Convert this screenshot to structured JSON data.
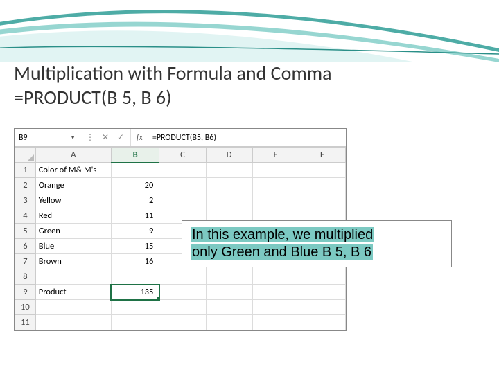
{
  "slide": {
    "title_line1": "Multiplication with Formula and Comma",
    "title_line2": "=PRODUCT(B 5, B 6)"
  },
  "excel": {
    "namebox": "B9",
    "fx_label": "fx",
    "formula": "=PRODUCT(B5, B6)",
    "columns": [
      "A",
      "B",
      "C",
      "D",
      "E",
      "F"
    ],
    "selected_column_index": 1,
    "rows": [
      {
        "n": 1,
        "a": "Color of M& M's",
        "b": ""
      },
      {
        "n": 2,
        "a": "Orange",
        "b": "20"
      },
      {
        "n": 3,
        "a": "Yellow",
        "b": "2"
      },
      {
        "n": 4,
        "a": "Red",
        "b": "11"
      },
      {
        "n": 5,
        "a": "Green",
        "b": "9"
      },
      {
        "n": 6,
        "a": "Blue",
        "b": "15"
      },
      {
        "n": 7,
        "a": "Brown",
        "b": "16"
      },
      {
        "n": 8,
        "a": "",
        "b": ""
      },
      {
        "n": 9,
        "a": "Product",
        "b": "135"
      },
      {
        "n": 10,
        "a": "",
        "b": ""
      },
      {
        "n": 11,
        "a": "",
        "b": ""
      }
    ],
    "active_cell": {
      "row": 9,
      "col": "B"
    }
  },
  "callout": {
    "line1": "In this example, we multiplied",
    "line2": "only Green and Blue B 5, B 6"
  },
  "colors": {
    "swoosh_teal": "#3aa9a1",
    "excel_green": "#1f7246"
  }
}
